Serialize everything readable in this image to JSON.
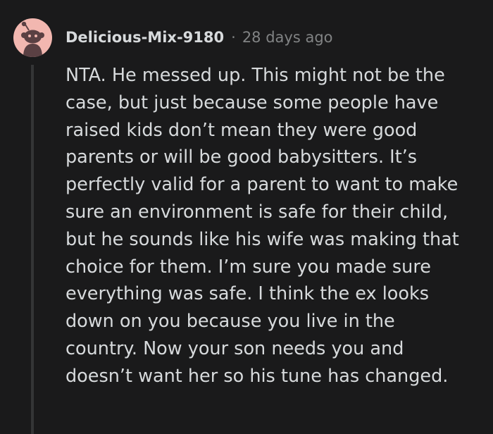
{
  "comment": {
    "author": "Delicious-Mix-9180",
    "separator": "·",
    "time_ago": "28 days ago",
    "avatar_icon": "reddit-snoo-icon",
    "colors": {
      "background": "#1a1a1b",
      "avatar_bg": "#f2b7b0",
      "avatar_figure": "#5a4043",
      "text": "#d7dadc",
      "muted": "#818384",
      "thread_line": "#343536"
    },
    "body_lines": [
      "NTA. He messed up. This might not be the",
      "case, but just because some people have",
      "raised kids don’t mean they were good",
      "parents or will be good babysitters. It’s",
      "perfectly valid for a parent to want to make",
      "sure an environment is safe for their child,",
      "but he sounds like his wife was making that",
      "choice for them. I’m sure you made sure",
      "everything was safe. I think the ex looks",
      "down on you because you live in the",
      "country. Now your son needs you and",
      "doesn’t want her so his tune has changed."
    ]
  }
}
